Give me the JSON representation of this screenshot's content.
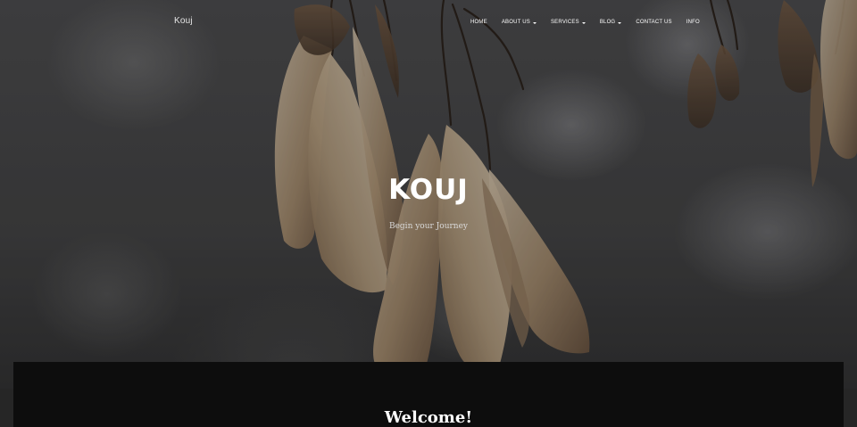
{
  "navbar": {
    "brand": "Kouj",
    "items": [
      {
        "label": "Home",
        "has_dropdown": false
      },
      {
        "label": "About Us",
        "has_dropdown": true
      },
      {
        "label": "Services",
        "has_dropdown": true
      },
      {
        "label": "Blog",
        "has_dropdown": true
      },
      {
        "label": "Contact Us",
        "has_dropdown": false
      },
      {
        "label": "Info",
        "has_dropdown": false
      }
    ],
    "dropdown_icon": "caret-down-icon"
  },
  "hero": {
    "title": "KOUJ",
    "subtitle": "Begin your Journey",
    "background_image": "dried-maple-seeds-photo"
  },
  "content": {
    "heading": "Welcome!"
  },
  "colors": {
    "text": "#ffffff",
    "panel": "#0d0d0d",
    "band": "#262626"
  }
}
